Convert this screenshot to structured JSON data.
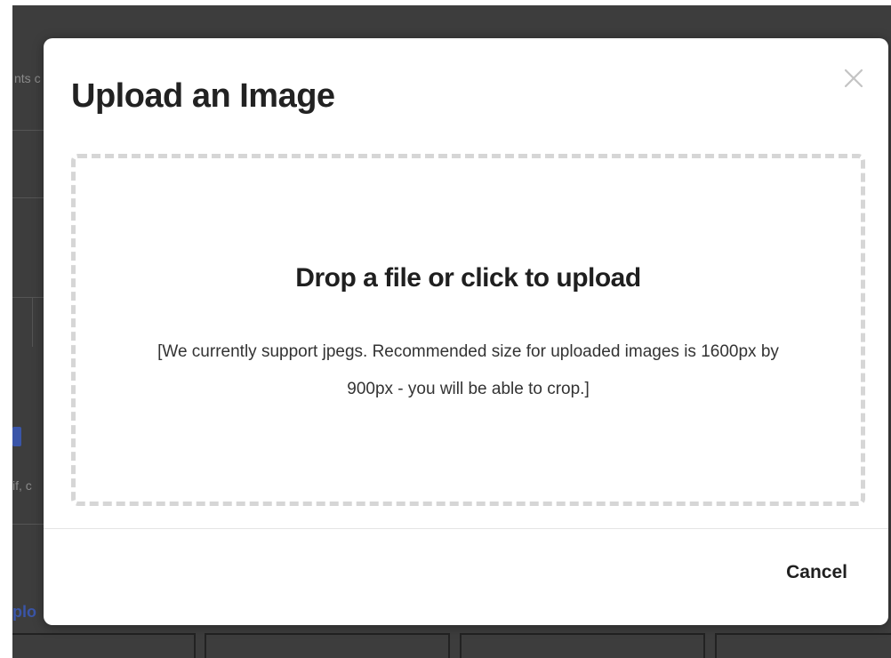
{
  "background": {
    "partial_text_top": "nts c",
    "partial_text_bottom": "if, c",
    "partial_link": "plo"
  },
  "modal": {
    "title": "Upload an Image",
    "close_icon": "close-icon",
    "dropzone": {
      "title": "Drop a file or click to upload",
      "description": "[We currently support jpegs. Recommended size for uploaded images is 1600px by 900px - you will be able to crop.]"
    },
    "footer": {
      "cancel_label": "Cancel"
    }
  },
  "colors": {
    "overlay": "#3d3d3d",
    "modal_bg": "#ffffff",
    "text_primary": "#222222",
    "dropzone_border": "#d6d6d6",
    "link_blue": "#3a55a8"
  }
}
